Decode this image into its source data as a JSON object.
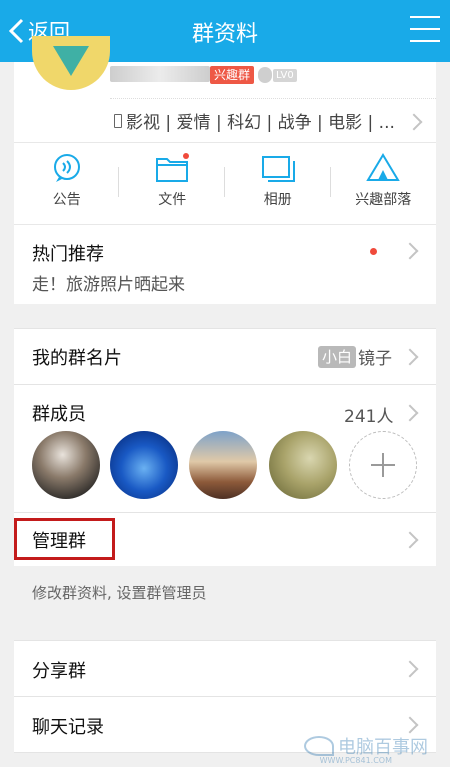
{
  "topbar": {
    "back_label": "返回",
    "title": "群资料",
    "menu_icon": "menu-icon",
    "bg_color": "#19aae8"
  },
  "group_header": {
    "badge": "兴趣群",
    "level": "LV0",
    "tags": "影视 | 爱情 | 科幻 | 战争 | 电影 | ..."
  },
  "quick_actions": [
    {
      "label": "公告",
      "icon": "announcement-icon"
    },
    {
      "label": "文件",
      "icon": "folder-icon"
    },
    {
      "label": "相册",
      "icon": "album-icon"
    },
    {
      "label": "兴趣部落",
      "icon": "tribe-tent-icon"
    }
  ],
  "hot": {
    "title": "热门推荐",
    "subtitle": "走！旅游照片晒起来"
  },
  "my_card": {
    "label": "我的群名片",
    "badge": "小白",
    "value": "镜子"
  },
  "members": {
    "label": "群成员",
    "count": "241人"
  },
  "manage": {
    "label": "管理群",
    "description": "修改群资料, 设置群管理员"
  },
  "share": {
    "label": "分享群"
  },
  "history": {
    "label": "聊天记录"
  },
  "watermark": {
    "text": "电脑百事网",
    "url": "WWW.PC841.COM"
  }
}
